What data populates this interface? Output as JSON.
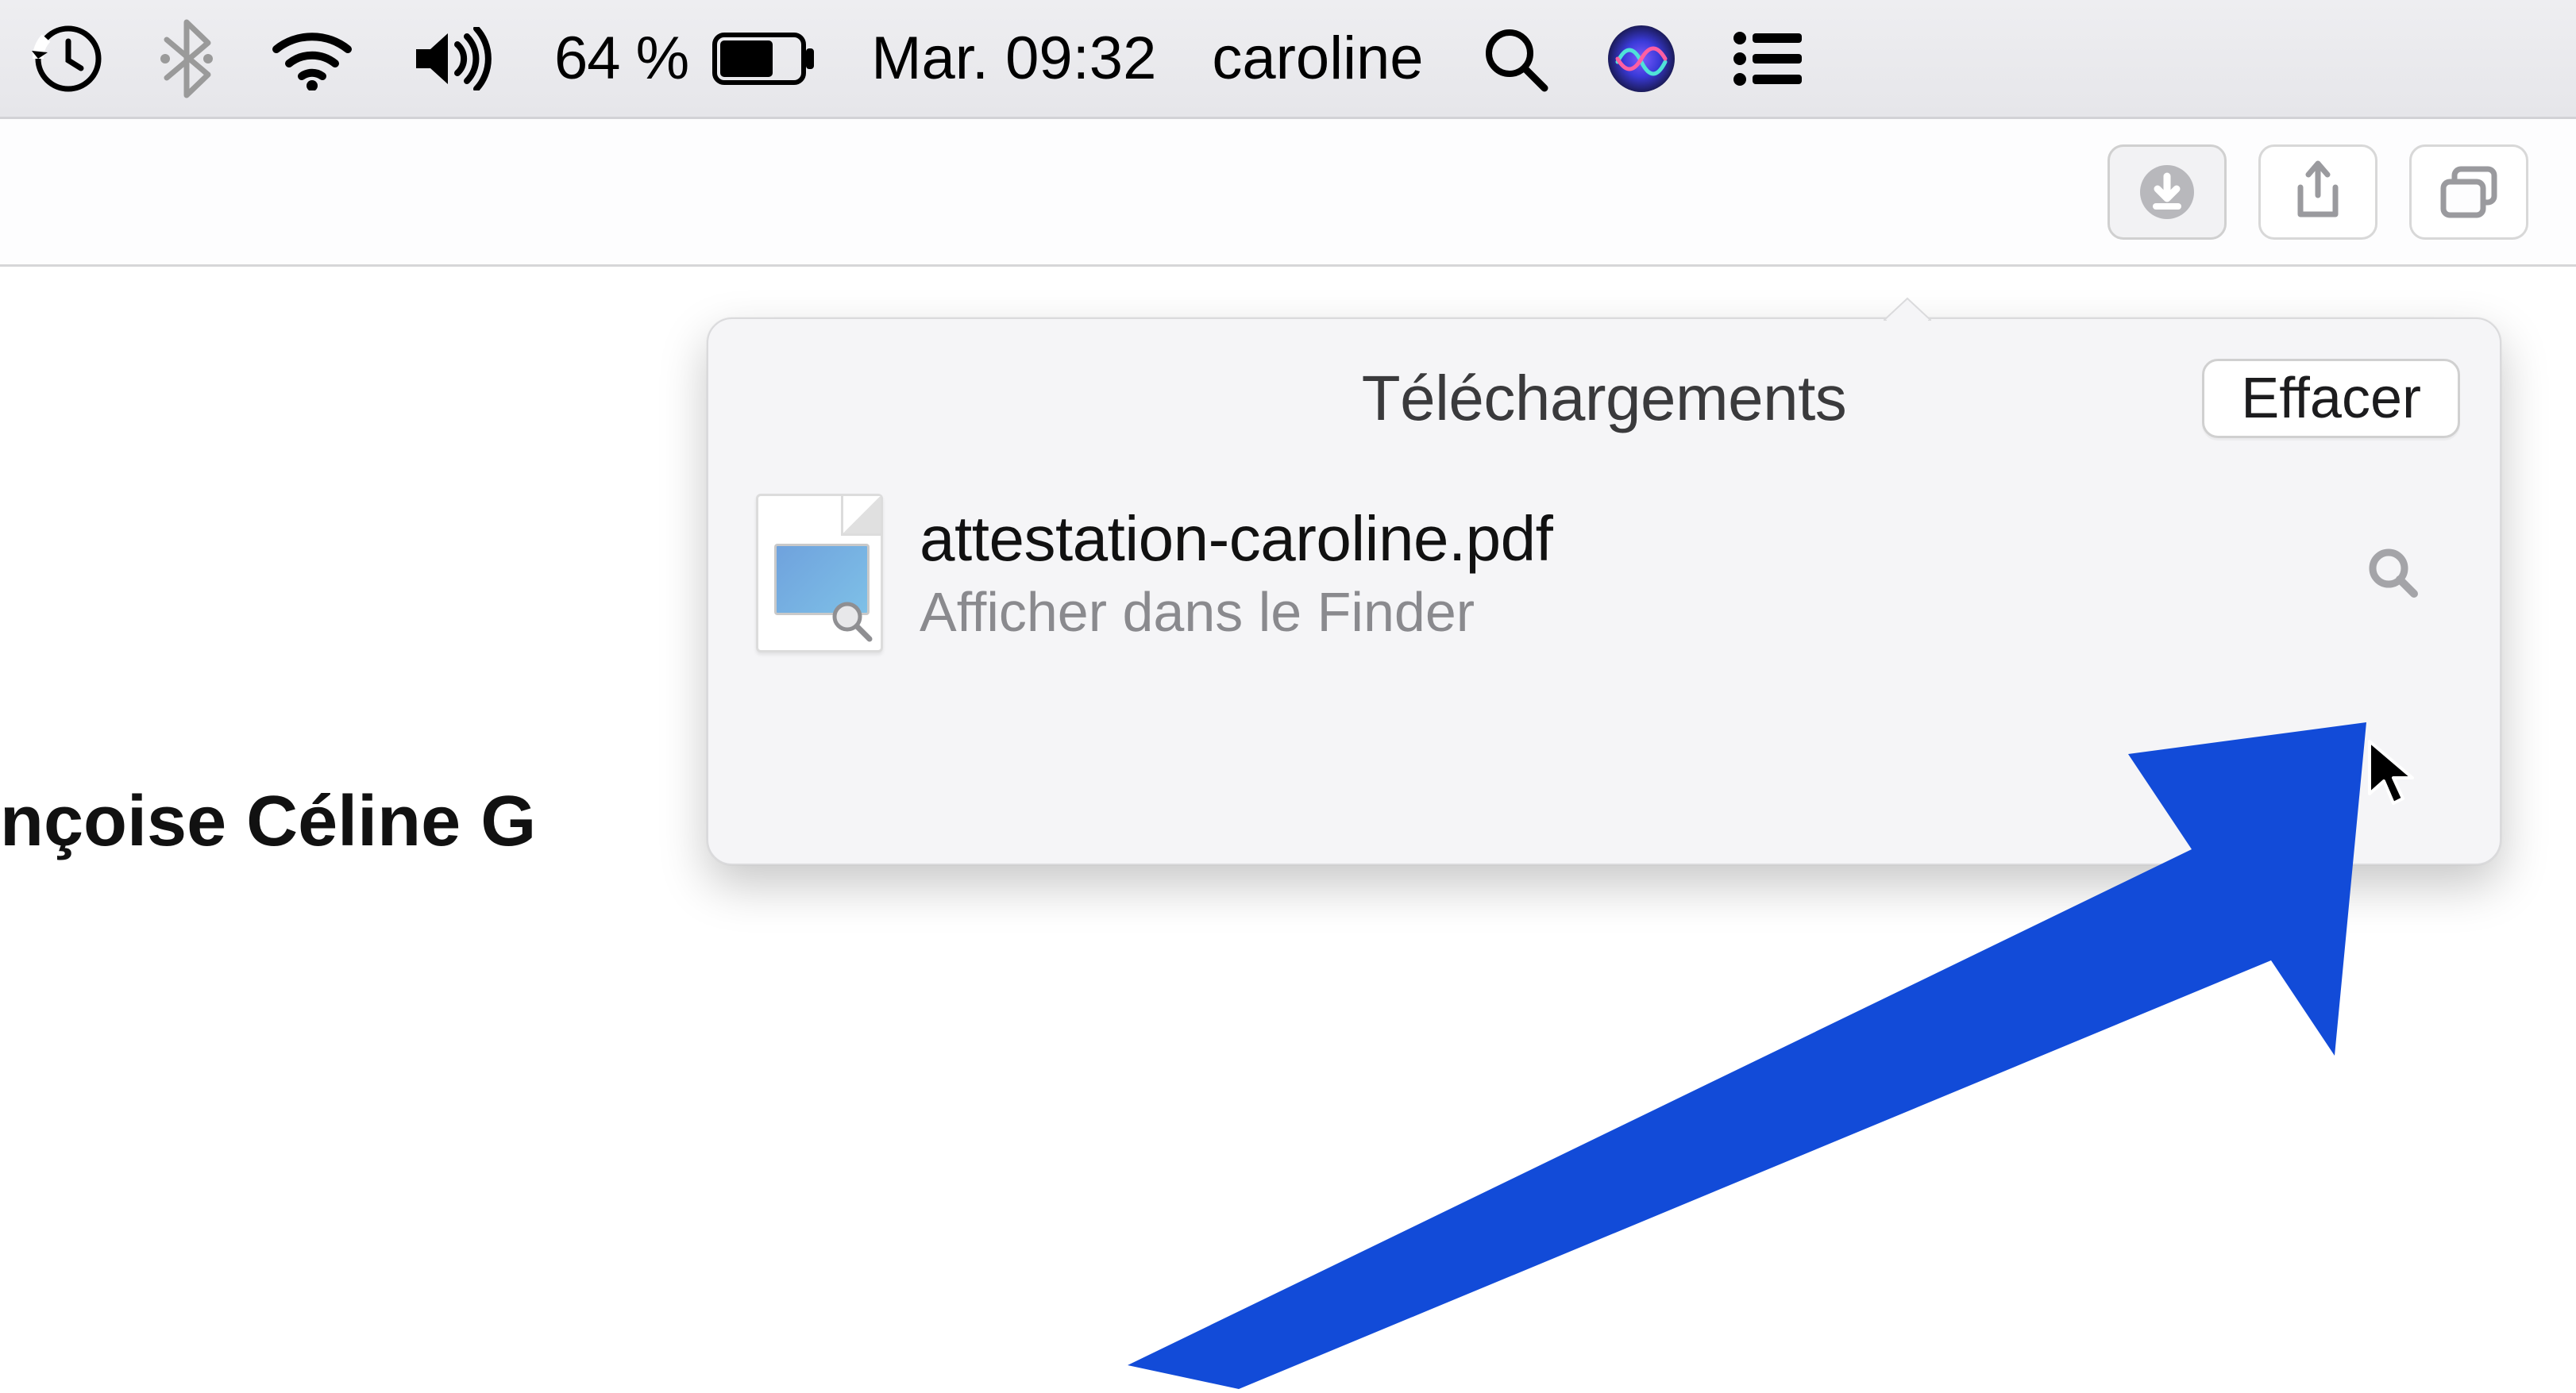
{
  "menubar": {
    "battery_percent": "64 %",
    "date_time": "Mar. 09:32",
    "username": "caroline"
  },
  "toolbar": {},
  "page": {
    "visible_heading_fragment": "nçoise Céline G"
  },
  "downloads_popover": {
    "title": "Téléchargements",
    "clear_label": "Effacer",
    "items": [
      {
        "filename": "attestation-caroline.pdf",
        "subtitle": "Afficher dans le Finder"
      }
    ]
  }
}
